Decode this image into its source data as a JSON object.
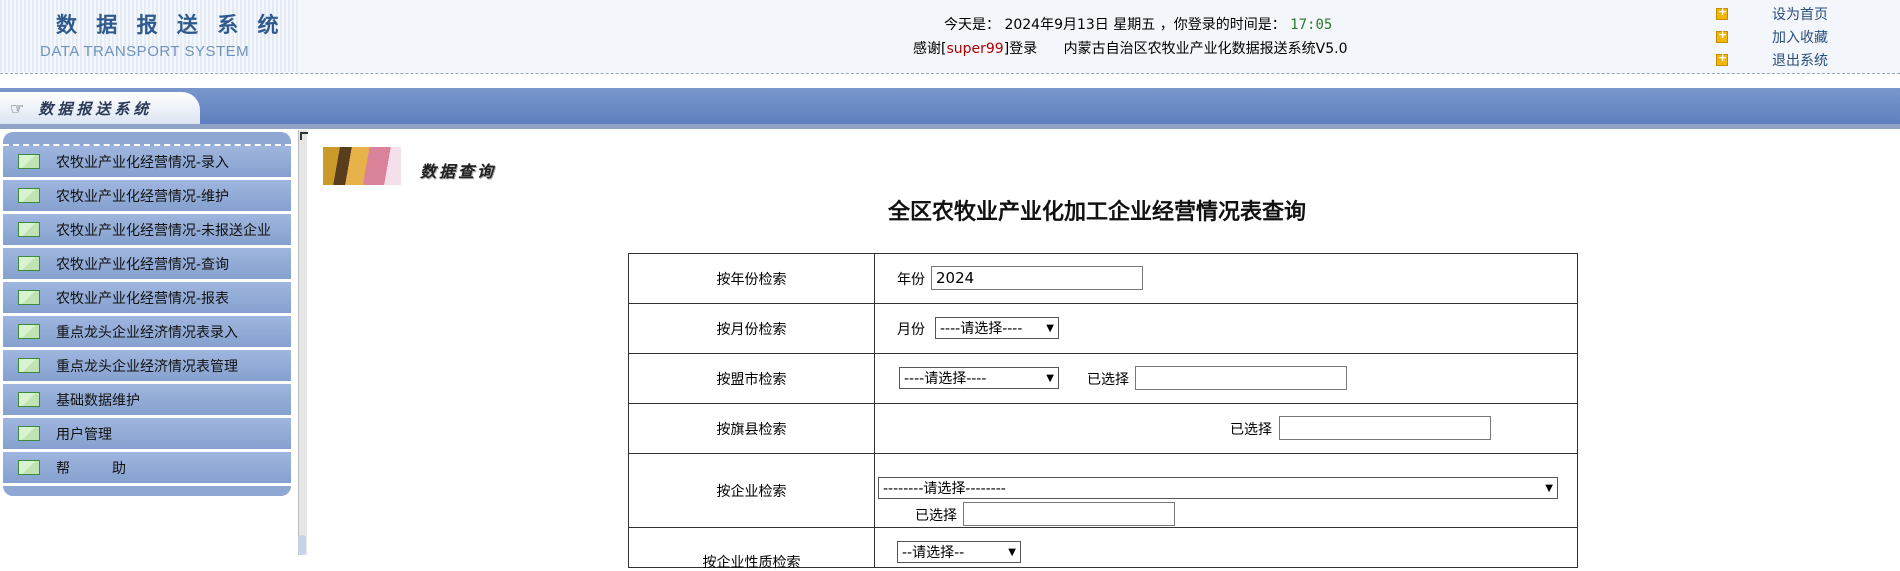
{
  "header": {
    "logo_cn": "数 据 报 送 系 统",
    "logo_en": "DATA TRANSPORT SYSTEM",
    "today_label": "今天是：",
    "date": "2024年9月13日",
    "weekday": "星期五",
    "login_time_label": "，你登录的时间是：",
    "login_time": "17:05",
    "thanks_prefix": "感谢[",
    "username": "super99",
    "thanks_suffix": "]登录",
    "system_name": "内蒙古自治区农牧业产业化数据报送系统V5.0",
    "links": {
      "home": "设为首页",
      "favorite": "加入收藏",
      "logout": "退出系统"
    }
  },
  "nav": {
    "tab_label": "数据报送系统",
    "tab_icon": "pointing-hand-icon"
  },
  "sidebar": {
    "items": [
      {
        "label": "农牧业产业化经营情况-录入"
      },
      {
        "label": "农牧业产业化经营情况-维护"
      },
      {
        "label": "农牧业产业化经营情况-未报送企业"
      },
      {
        "label": "农牧业产业化经营情况-查询"
      },
      {
        "label": "农牧业产业化经营情况-报表"
      },
      {
        "label": "重点龙头企业经济情况表录入"
      },
      {
        "label": "重点龙头企业经济情况表管理"
      },
      {
        "label": "基础数据维护"
      },
      {
        "label": "用户管理"
      },
      {
        "label": "帮　　　助"
      }
    ]
  },
  "content": {
    "section_title": "数据查询",
    "page_title": "全区农牧业产业化加工企业经营情况表查询",
    "form": {
      "year_key": "按年份检索",
      "year_label": "年份",
      "year_value": "2024",
      "month_key": "按月份检索",
      "month_label": "月份",
      "month_selected": "----请选择----",
      "league_key": "按盟市检索",
      "league_selected": "----请选择----",
      "selected_label": "已选择",
      "county_key": "按旗县检索",
      "enterprise_key": "按企业检索",
      "enterprise_selected": "--------请选择--------",
      "row6_key": "按企业性质检索",
      "row6_selected": "--请选择--"
    }
  },
  "colors": {
    "nav_blue": "#6885c6",
    "sidebar_blue": "#8ea8d4",
    "username_red": "#b00000",
    "time_green": "#2a7a2a"
  }
}
